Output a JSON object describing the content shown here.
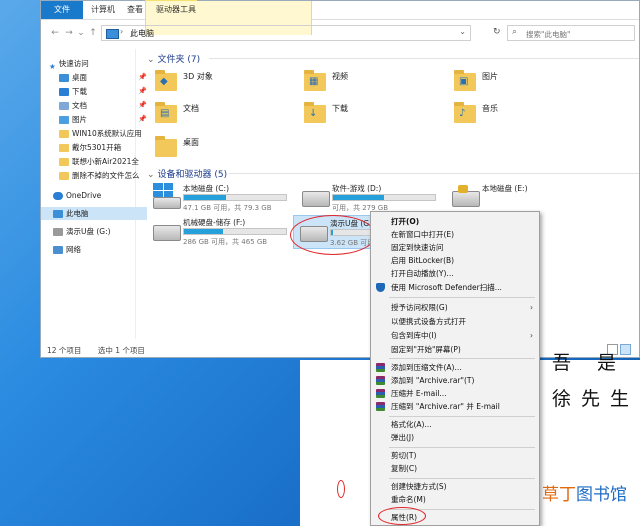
{
  "window": {
    "tabs": [
      "文件",
      "计算机",
      "查看"
    ],
    "context_tab": "驱动器工具",
    "address_path": "此电脑",
    "search_placeholder": "搜索\"此电脑\""
  },
  "sidebar": {
    "items": [
      {
        "label": "快速访问",
        "icon": "star-icon"
      },
      {
        "label": "桌面",
        "icon": "desktop-icon",
        "pinned": true
      },
      {
        "label": "下载",
        "icon": "download-icon",
        "pinned": true
      },
      {
        "label": "文档",
        "icon": "document-icon",
        "pinned": true
      },
      {
        "label": "图片",
        "icon": "picture-icon",
        "pinned": true
      },
      {
        "label": "WIN10系统默认应用",
        "icon": "folder-icon"
      },
      {
        "label": "戴尔5301开箱",
        "icon": "folder-icon"
      },
      {
        "label": "联想小新Air2021全",
        "icon": "folder-icon"
      },
      {
        "label": "删除不掉的文件怎么",
        "icon": "folder-icon"
      },
      {
        "label": "OneDrive",
        "icon": "cloud-icon"
      },
      {
        "label": "此电脑",
        "icon": "computer-icon",
        "selected": true
      },
      {
        "label": "演示U盘 (G:)",
        "icon": "usb-drive-icon"
      },
      {
        "label": "网络",
        "icon": "network-icon"
      }
    ]
  },
  "folders_section": {
    "title": "文件夹 (7)",
    "items": [
      "3D 对象",
      "视频",
      "图片",
      "文档",
      "下载",
      "音乐",
      "桌面"
    ]
  },
  "drives_section": {
    "title": "设备和驱动器 (5)",
    "items": [
      {
        "name": "本地磁盘 (C:)",
        "free": "47.1 GB 可用，共 79.3 GB",
        "used_fraction": 0.41
      },
      {
        "name": "软件-游戏 (D:)",
        "free": "可用，共 279 GB",
        "used_fraction": 0.5
      },
      {
        "name": "本地磁盘 (E:)",
        "free": "",
        "used_fraction": 0
      },
      {
        "name": "机械硬盘-储存 (F:)",
        "free": "286 GB 可用，共 465 GB",
        "used_fraction": 0.38
      },
      {
        "name": "演示U盘 (G:)",
        "free": "3.62 GB 可用",
        "used_fraction": 0.05
      }
    ]
  },
  "status": {
    "count": "12 个项目",
    "selected": "选中 1 个项目"
  },
  "context_menu": {
    "items": [
      {
        "label": "打开(O)",
        "bold": true
      },
      {
        "label": "在新窗口中打开(E)"
      },
      {
        "label": "固定到快速访问"
      },
      {
        "label": "启用 BitLocker(B)"
      },
      {
        "label": "打开自动播放(Y)..."
      },
      {
        "label": "使用 Microsoft Defender扫描...",
        "icon": "shield-icon"
      },
      {
        "label": "授予访问权限(G)",
        "submenu": true
      },
      {
        "label": "以便携式设备方式打开"
      },
      {
        "label": "包含到库中(I)",
        "submenu": true
      },
      {
        "label": "固定到\"开始\"屏幕(P)"
      },
      {
        "label": "添加到压缩文件(A)...",
        "icon": "winrar-icon"
      },
      {
        "label": "添加到 \"Archive.rar\"(T)",
        "icon": "winrar-icon"
      },
      {
        "label": "压缩并 E-mail...",
        "icon": "winrar-icon"
      },
      {
        "label": "压缩到 \"Archive.rar\" 并 E-mail",
        "icon": "winrar-icon"
      },
      {
        "label": "格式化(A)..."
      },
      {
        "label": "弹出(J)"
      },
      {
        "label": "剪切(T)"
      },
      {
        "label": "复制(C)"
      },
      {
        "label": "创建快捷方式(S)"
      },
      {
        "label": "重命名(M)"
      },
      {
        "label": "属性(R)"
      }
    ]
  },
  "overlay": {
    "line1": "吾 是",
    "line2": "徐先生",
    "watermark_a": "草丁",
    "watermark_b": "图书馆"
  },
  "colors": {
    "accent": "#1979ca",
    "highlight": "#cce4f7",
    "annotation": "#e0282e"
  }
}
